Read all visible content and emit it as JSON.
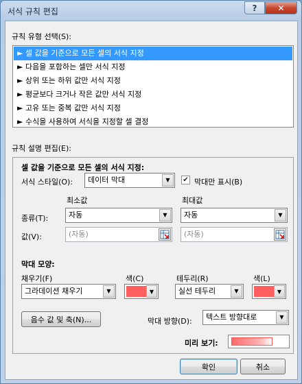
{
  "window": {
    "title": "서식 규칙 편집",
    "help_label": "?",
    "close_label": "✕"
  },
  "rule_type": {
    "label": "규칙 유형 선택(S):",
    "items": [
      "► 셀 값을 기준으로 모든 셀의 서식 지정",
      "► 다음을 포함하는 셀만 서식 지정",
      "► 상위 또는 하위 값만 서식 지정",
      "► 평균보다 크거나 작은 값만 서식 지정",
      "► 고유 또는 중복 값만 서식 지정",
      "► 수식을 사용하여 서식을 지정할 셀 결정"
    ],
    "selected_index": 0
  },
  "rule_desc": {
    "label": "규칙 설명 편집(E):",
    "heading": "셀 값을 기준으로 모든 셀의 서식 지정:",
    "format_style_label": "서식 스타일(O):",
    "format_style_value": "데이터 막대",
    "bar_only_label": "막대만 표시(B)",
    "bar_only_checked": true,
    "min_header": "최소값",
    "max_header": "최대값",
    "type_label": "종류(T):",
    "min_type": "자동",
    "max_type": "자동",
    "value_label": "값(V):",
    "min_value_placeholder": "(자동)",
    "max_value_placeholder": "(자동)",
    "bar_appearance_label": "막대 모양:",
    "fill_label": "채우기(F)",
    "fill_value": "그라데이션 채우기",
    "fill_color_label": "색(C)",
    "fill_color": "#ff5f5f",
    "border_label": "테두리(R)",
    "border_value": "실선 테두리",
    "border_color_label": "색(L)",
    "border_color": "#ff5f5f",
    "negative_button": "음수 값 및 축(N)...",
    "direction_label": "막대 방향(D):",
    "direction_value": "텍스트 방향대로",
    "preview_label": "미리 보기:"
  },
  "buttons": {
    "ok": "확인",
    "cancel": "취소"
  }
}
